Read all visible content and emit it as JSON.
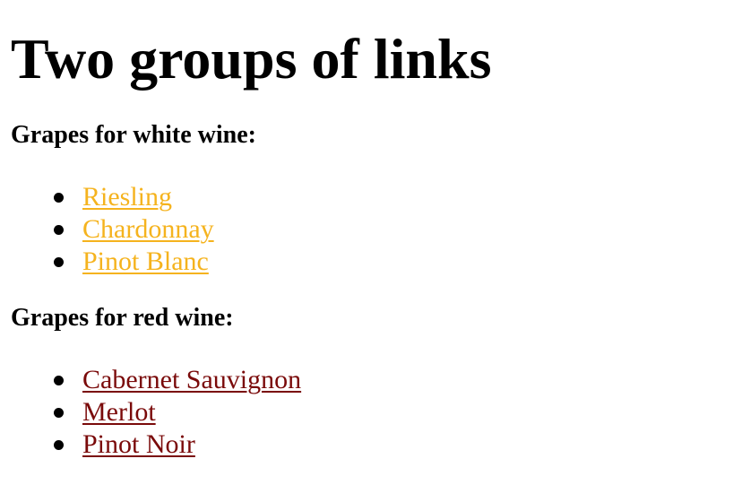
{
  "page": {
    "title": "Two groups of links"
  },
  "white": {
    "heading": "Grapes for white wine:",
    "color": "#f5b31e",
    "items": [
      "Riesling",
      "Chardonnay",
      "Pinot Blanc"
    ]
  },
  "red": {
    "heading": "Grapes for red wine:",
    "color": "#7a0a0a",
    "items": [
      "Cabernet Sauvignon",
      "Merlot",
      "Pinot Noir"
    ]
  }
}
